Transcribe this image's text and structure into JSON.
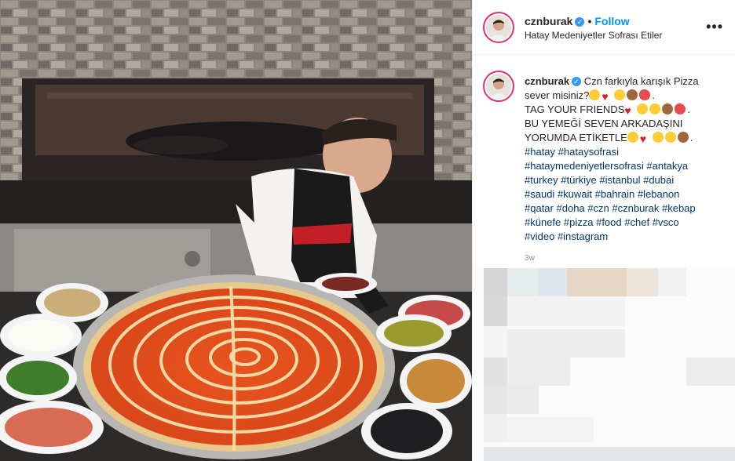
{
  "header": {
    "username": "cznburak",
    "separator": "•",
    "follow_label": "Follow",
    "location": "Hatay Medeniyetler Sofrası Etiler",
    "more_label": "•••"
  },
  "caption": {
    "username": "cznburak",
    "lines": [
      "Czn farkıyla karışık Pizza",
      "sever misiniz?",
      "TAG YOUR FRIENDS",
      "BU YEMEĞİ SEVEN ARKADAŞINI",
      "YORUMDA ETİKETLE"
    ],
    "hashtags": [
      "#hatay",
      "#hataysofrasi",
      "#hataymedeniyetlersofrasi",
      "#antakya",
      "#turkey",
      "#türkiye",
      "#istanbul",
      "#dubai",
      "#saudi",
      "#kuwait",
      "#bahrain",
      "#lebanon",
      "#qatar",
      "#doha",
      "#czn",
      "#cznburak",
      "#kebap",
      "#künefe",
      "#pizza",
      "#food",
      "#chef",
      "#vsco",
      "#video",
      "#instagram"
    ],
    "timestamp": "3w"
  },
  "icons": {
    "verified": "verified-badge-icon",
    "more": "more-options-icon"
  },
  "colors": {
    "accent_blue": "#0095f6",
    "hashtag": "#00376b",
    "verified": "#3897f0",
    "muted": "#8e8e8e"
  }
}
